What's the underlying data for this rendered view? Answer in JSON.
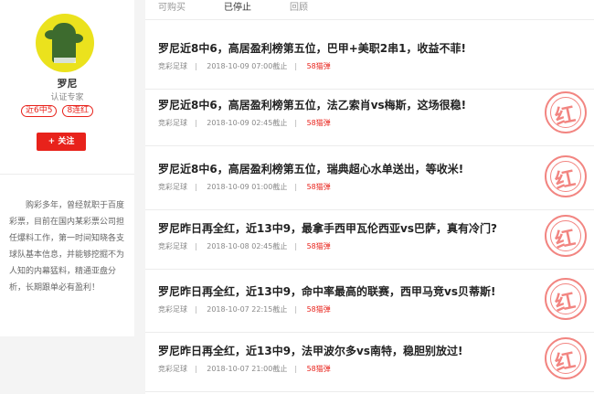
{
  "profile": {
    "name": "罗尼",
    "cert": "认证专家",
    "badges": [
      "近6中5",
      "8连红"
    ],
    "follow_label": "+ 关注",
    "bio": "购彩多年，曾经就职于百度彩票，目前在国内某彩票公司担任爆料工作，第一时间知晓各支球队基本信息，并能够挖掘不为人知的内幕猛料，精通亚盘分析，长期跟单必有盈利！"
  },
  "tabs": [
    {
      "label": "可购买",
      "active": false
    },
    {
      "label": "已停止",
      "active": true
    },
    {
      "label": "回顾",
      "active": false
    }
  ],
  "articles": [
    {
      "title": "罗尼近8中6，高居盈利榜第五位，巴甲+美职2串1，收益不菲!",
      "category": "竞彩足球",
      "time": "2018-10-09 07:00截止",
      "price": "58猫弹",
      "stamp": false
    },
    {
      "title": "罗尼近8中6，高居盈利榜第五位，法乙索肖vs梅斯，这场很稳!",
      "category": "竞彩足球",
      "time": "2018-10-09 02:45截止",
      "price": "58猫弹",
      "stamp": true
    },
    {
      "title": "罗尼近8中6，高居盈利榜第五位，瑞典超心水单送出，等收米!",
      "category": "竞彩足球",
      "time": "2018-10-09 01:00截止",
      "price": "58猫弹",
      "stamp": true
    },
    {
      "title": "罗尼昨日再全红，近13中9，最拿手西甲瓦伦西亚vs巴萨，真有冷门?",
      "category": "竞彩足球",
      "time": "2018-10-08 02:45截止",
      "price": "58猫弹",
      "stamp": true
    },
    {
      "title": "罗尼昨日再全红，近13中9，命中率最高的联赛，西甲马竞vs贝蒂斯!",
      "category": "竞彩足球",
      "time": "2018-10-07 22:15截止",
      "price": "58猫弹",
      "stamp": true
    },
    {
      "title": "罗尼昨日再全红，近13中9，法甲波尔多vs南特，稳胆别放过!",
      "category": "竞彩足球",
      "time": "2018-10-07 21:00截止",
      "price": "58猫弹",
      "stamp": true
    }
  ],
  "stamp_char": "红",
  "accent_color": "#e8221b"
}
